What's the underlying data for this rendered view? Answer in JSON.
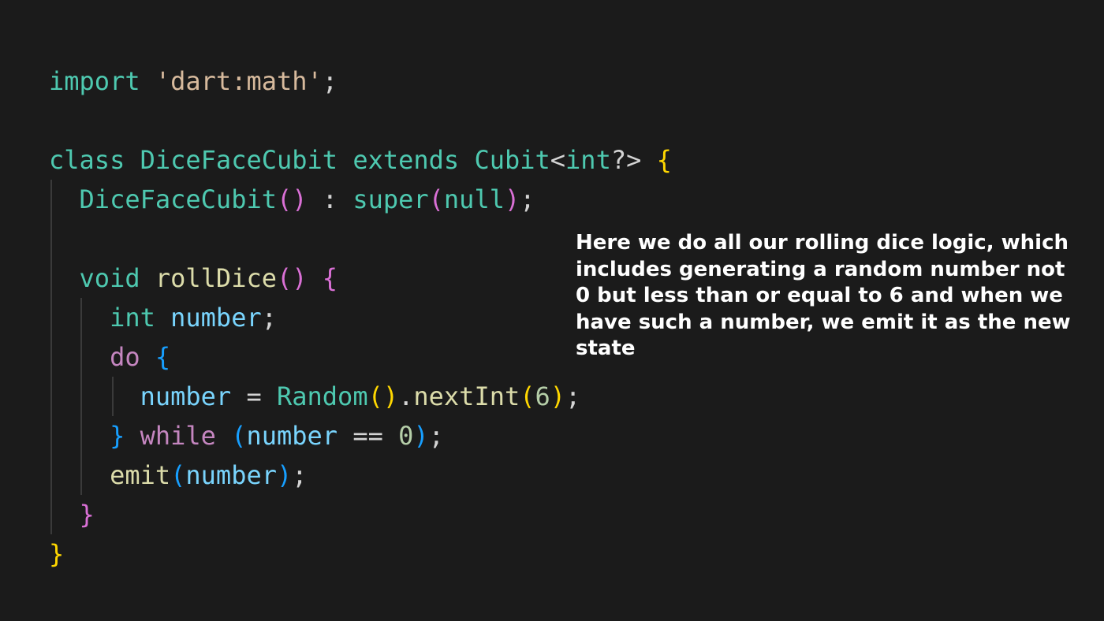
{
  "code": {
    "lines": [
      {
        "tokens": [
          {
            "t": "import",
            "c": "kw"
          },
          {
            "t": " ",
            "c": "punct"
          },
          {
            "t": "'dart:math'",
            "c": "str"
          },
          {
            "t": ";",
            "c": "punct"
          }
        ]
      },
      {
        "tokens": []
      },
      {
        "tokens": [
          {
            "t": "class",
            "c": "kw"
          },
          {
            "t": " ",
            "c": "punct"
          },
          {
            "t": "DiceFaceCubit",
            "c": "cls"
          },
          {
            "t": " ",
            "c": "punct"
          },
          {
            "t": "extends",
            "c": "kw"
          },
          {
            "t": " ",
            "c": "punct"
          },
          {
            "t": "Cubit",
            "c": "cls"
          },
          {
            "t": "<",
            "c": "punct"
          },
          {
            "t": "int",
            "c": "typ"
          },
          {
            "t": "?>",
            "c": "punct"
          },
          {
            "t": " ",
            "c": "punct"
          },
          {
            "t": "{",
            "c": "brace-y"
          }
        ]
      },
      {
        "tokens": [
          {
            "t": "  ",
            "c": "punct"
          },
          {
            "t": "DiceFaceCubit",
            "c": "cls"
          },
          {
            "t": "()",
            "c": "brace-p"
          },
          {
            "t": " : ",
            "c": "punct"
          },
          {
            "t": "super",
            "c": "kw"
          },
          {
            "t": "(",
            "c": "brace-p"
          },
          {
            "t": "null",
            "c": "kw"
          },
          {
            "t": ")",
            "c": "brace-p"
          },
          {
            "t": ";",
            "c": "punct"
          }
        ]
      },
      {
        "tokens": []
      },
      {
        "tokens": [
          {
            "t": "  ",
            "c": "punct"
          },
          {
            "t": "void",
            "c": "kw"
          },
          {
            "t": " ",
            "c": "punct"
          },
          {
            "t": "rollDice",
            "c": "fn"
          },
          {
            "t": "()",
            "c": "brace-p"
          },
          {
            "t": " ",
            "c": "punct"
          },
          {
            "t": "{",
            "c": "brace-p"
          }
        ]
      },
      {
        "tokens": [
          {
            "t": "    ",
            "c": "punct"
          },
          {
            "t": "int",
            "c": "typ"
          },
          {
            "t": " ",
            "c": "punct"
          },
          {
            "t": "number",
            "c": "var"
          },
          {
            "t": ";",
            "c": "punct"
          }
        ]
      },
      {
        "tokens": [
          {
            "t": "    ",
            "c": "punct"
          },
          {
            "t": "do",
            "c": "ctl"
          },
          {
            "t": " ",
            "c": "punct"
          },
          {
            "t": "{",
            "c": "brace-b"
          }
        ]
      },
      {
        "tokens": [
          {
            "t": "      ",
            "c": "punct"
          },
          {
            "t": "number",
            "c": "var"
          },
          {
            "t": " = ",
            "c": "punct"
          },
          {
            "t": "Random",
            "c": "cls"
          },
          {
            "t": "()",
            "c": "brace-y"
          },
          {
            "t": ".",
            "c": "punct"
          },
          {
            "t": "nextInt",
            "c": "fn"
          },
          {
            "t": "(",
            "c": "brace-y"
          },
          {
            "t": "6",
            "c": "num"
          },
          {
            "t": ")",
            "c": "brace-y"
          },
          {
            "t": ";",
            "c": "punct"
          }
        ]
      },
      {
        "tokens": [
          {
            "t": "    ",
            "c": "punct"
          },
          {
            "t": "}",
            "c": "brace-b"
          },
          {
            "t": " ",
            "c": "punct"
          },
          {
            "t": "while",
            "c": "ctl"
          },
          {
            "t": " ",
            "c": "punct"
          },
          {
            "t": "(",
            "c": "brace-b"
          },
          {
            "t": "number",
            "c": "var"
          },
          {
            "t": " == ",
            "c": "punct"
          },
          {
            "t": "0",
            "c": "num"
          },
          {
            "t": ")",
            "c": "brace-b"
          },
          {
            "t": ";",
            "c": "punct"
          }
        ]
      },
      {
        "tokens": [
          {
            "t": "    ",
            "c": "punct"
          },
          {
            "t": "emit",
            "c": "fn"
          },
          {
            "t": "(",
            "c": "brace-b"
          },
          {
            "t": "number",
            "c": "var"
          },
          {
            "t": ")",
            "c": "brace-b"
          },
          {
            "t": ";",
            "c": "punct"
          }
        ]
      },
      {
        "tokens": [
          {
            "t": "  ",
            "c": "punct"
          },
          {
            "t": "}",
            "c": "brace-p"
          }
        ]
      },
      {
        "tokens": [
          {
            "t": "}",
            "c": "brace-y"
          }
        ]
      }
    ]
  },
  "annotation": {
    "text": "Here we do all our rolling dice logic, which includes generating a random number not 0 but less than or equal to 6 and when we have such a number, we emit it as the new state"
  },
  "colors": {
    "background": "#1b1b1b",
    "keyword": "#4ec9b0",
    "string": "#d7ba9d",
    "variable": "#79d4fd",
    "function": "#dcdcaa",
    "number": "#b5cea8",
    "annotation_text": "#ffffff"
  }
}
